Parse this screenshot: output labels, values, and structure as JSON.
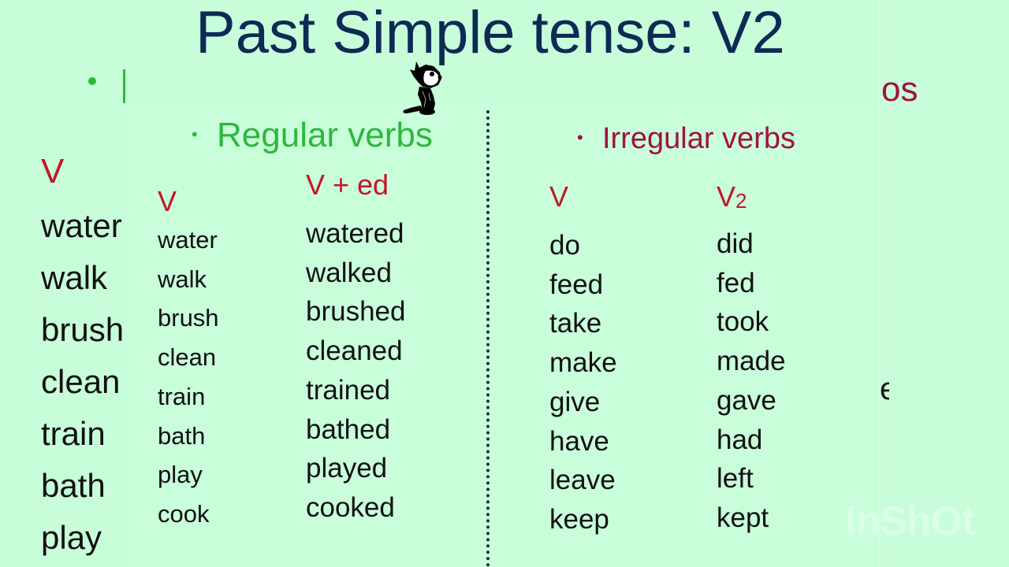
{
  "slide": {
    "title": "Past Simple tense: V2",
    "background_slide": {
      "fragment_right": "os",
      "fragment_right_lower": "e",
      "column_header": "V",
      "words": [
        "water",
        "walk",
        "brush",
        "clean",
        "train",
        "bath",
        "play"
      ]
    },
    "regular": {
      "bullet": "•",
      "heading": "Regular verbs",
      "col_v_header": "V",
      "col_ed_header": "V + ed",
      "base": [
        "water",
        "walk",
        "brush",
        "clean",
        "train",
        "bath",
        "play",
        "cook"
      ],
      "past": [
        "watered",
        "walked",
        "brushed",
        "cleaned",
        "trained",
        "bathed",
        "played",
        "cooked"
      ]
    },
    "irregular": {
      "bullet": "•",
      "heading": "Irregular verbs",
      "col_v_header": "V",
      "col_v2_header_main": "V",
      "col_v2_header_sub": "2",
      "base": [
        "do",
        "feed",
        "take",
        "make",
        "give",
        "have",
        "leave",
        "keep"
      ],
      "past": [
        "did",
        "fed",
        "took",
        "made",
        "gave",
        "had",
        "left",
        "kept"
      ]
    },
    "mascot": "cartoon-cat",
    "watermark": "InShOt"
  },
  "colors": {
    "background": "#c8fdd9",
    "title": "#0d2a55",
    "regular_accent": "#2db83d",
    "irregular_accent": "#a0123f",
    "header_red": "#c01828",
    "text": "#111111"
  }
}
